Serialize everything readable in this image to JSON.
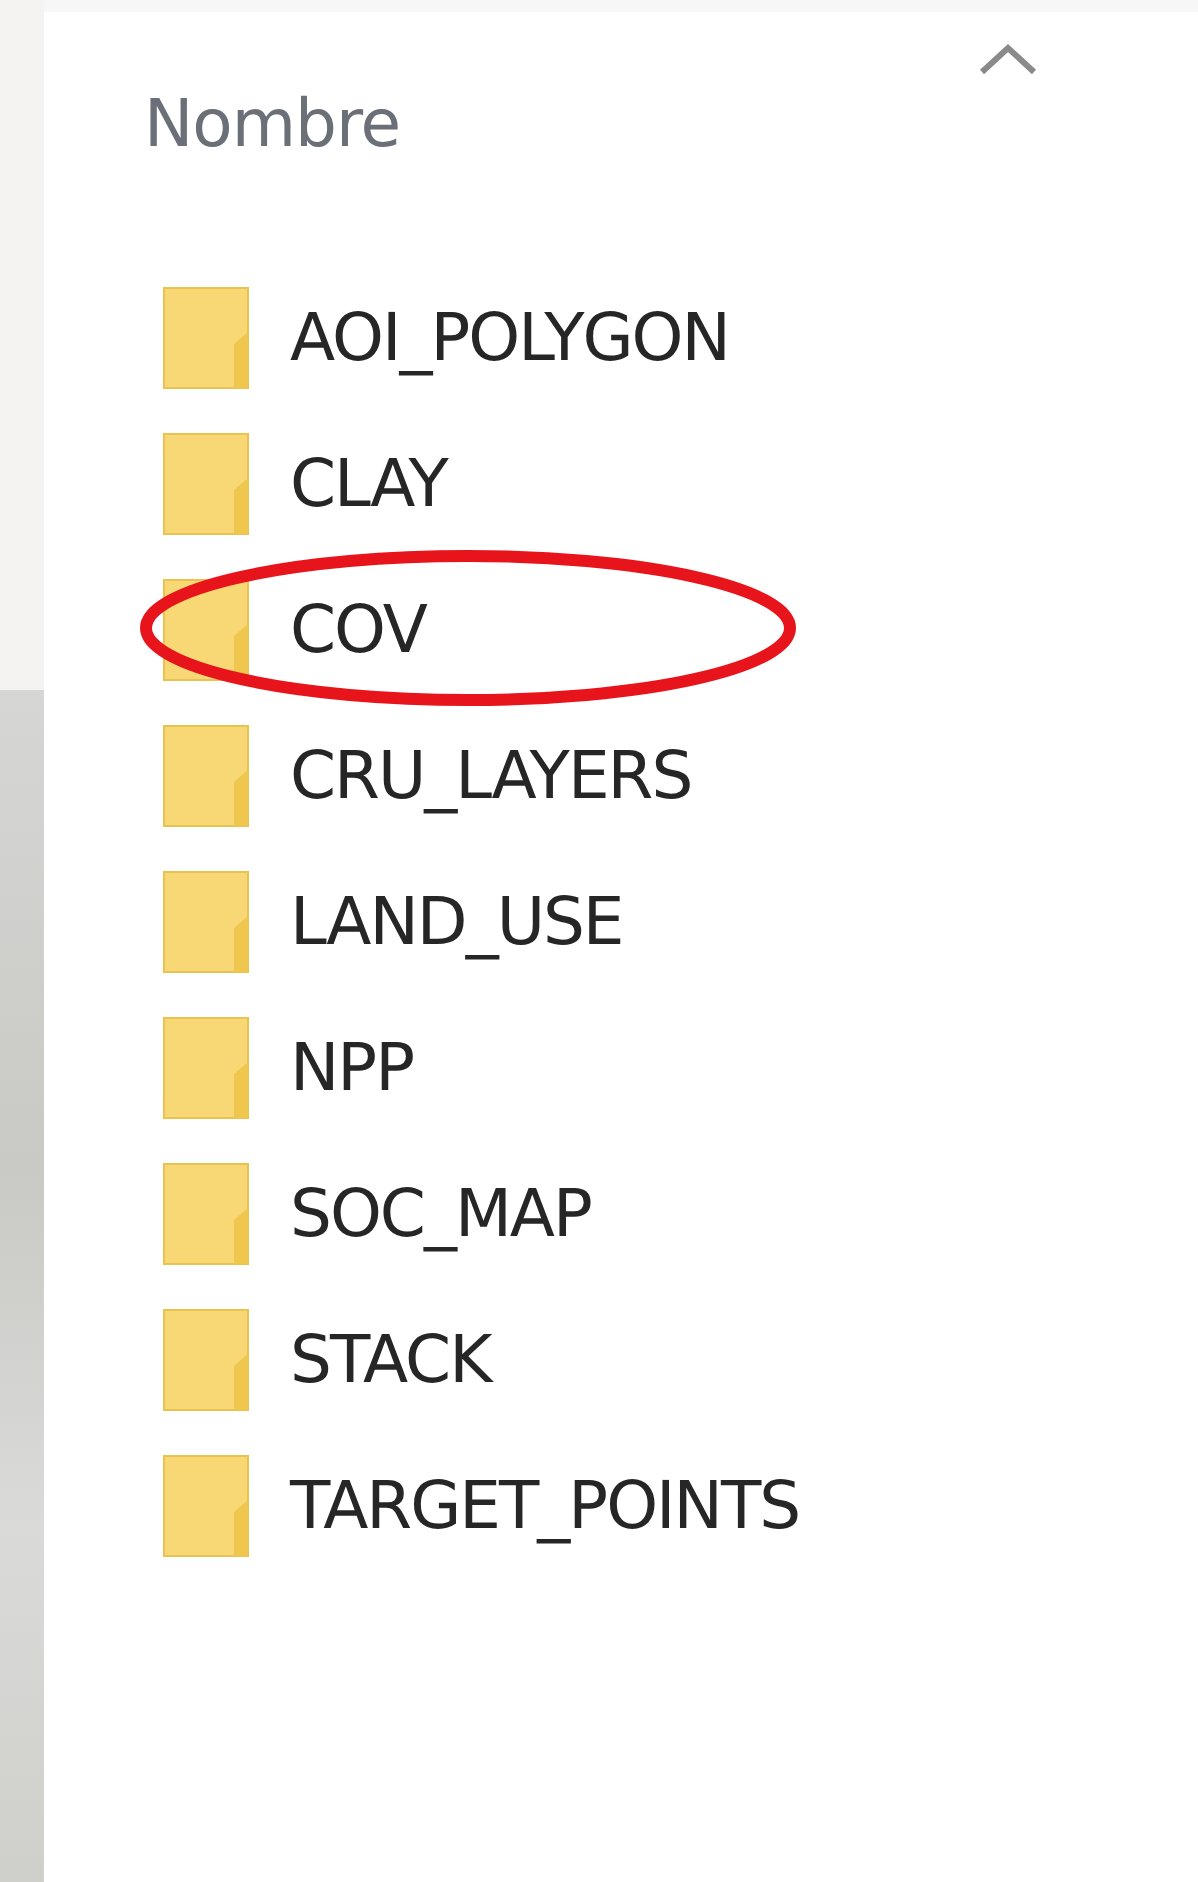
{
  "column_header": {
    "label": "Nombre",
    "sorted_ascending": true
  },
  "folders": [
    {
      "name": "AOI_POLYGON",
      "circled": false
    },
    {
      "name": "CLAY",
      "circled": false
    },
    {
      "name": "COV",
      "circled": true
    },
    {
      "name": "CRU_LAYERS",
      "circled": false
    },
    {
      "name": "LAND_USE",
      "circled": false
    },
    {
      "name": "NPP",
      "circled": false
    },
    {
      "name": "SOC_MAP",
      "circled": false
    },
    {
      "name": "STACK",
      "circled": false
    },
    {
      "name": "TARGET_POINTS",
      "circled": false
    }
  ]
}
